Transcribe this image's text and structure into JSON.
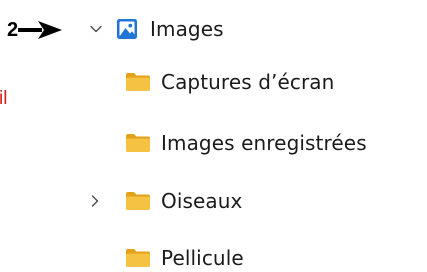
{
  "annotation": {
    "step_number": "2"
  },
  "edge_text": "il",
  "tree": {
    "root": {
      "label": "Images",
      "icon": "pictures-library-icon",
      "expanded": true
    },
    "children": [
      {
        "label": "Captures d’écran",
        "icon": "folder-icon",
        "has_children": false
      },
      {
        "label": "Images enregistrées",
        "icon": "folder-icon",
        "has_children": false
      },
      {
        "label": "Oiseaux",
        "icon": "folder-icon",
        "has_children": true
      },
      {
        "label": "Pellicule",
        "icon": "folder-icon",
        "has_children": false
      }
    ]
  },
  "colors": {
    "folder_yellow": "#f6c244",
    "folder_dark": "#e3a21a",
    "pictures_blue": "#1f74d6",
    "annotation_red": "#d41f1f",
    "chevron_gray": "#4a4a4a",
    "text": "#1b1b1b"
  }
}
